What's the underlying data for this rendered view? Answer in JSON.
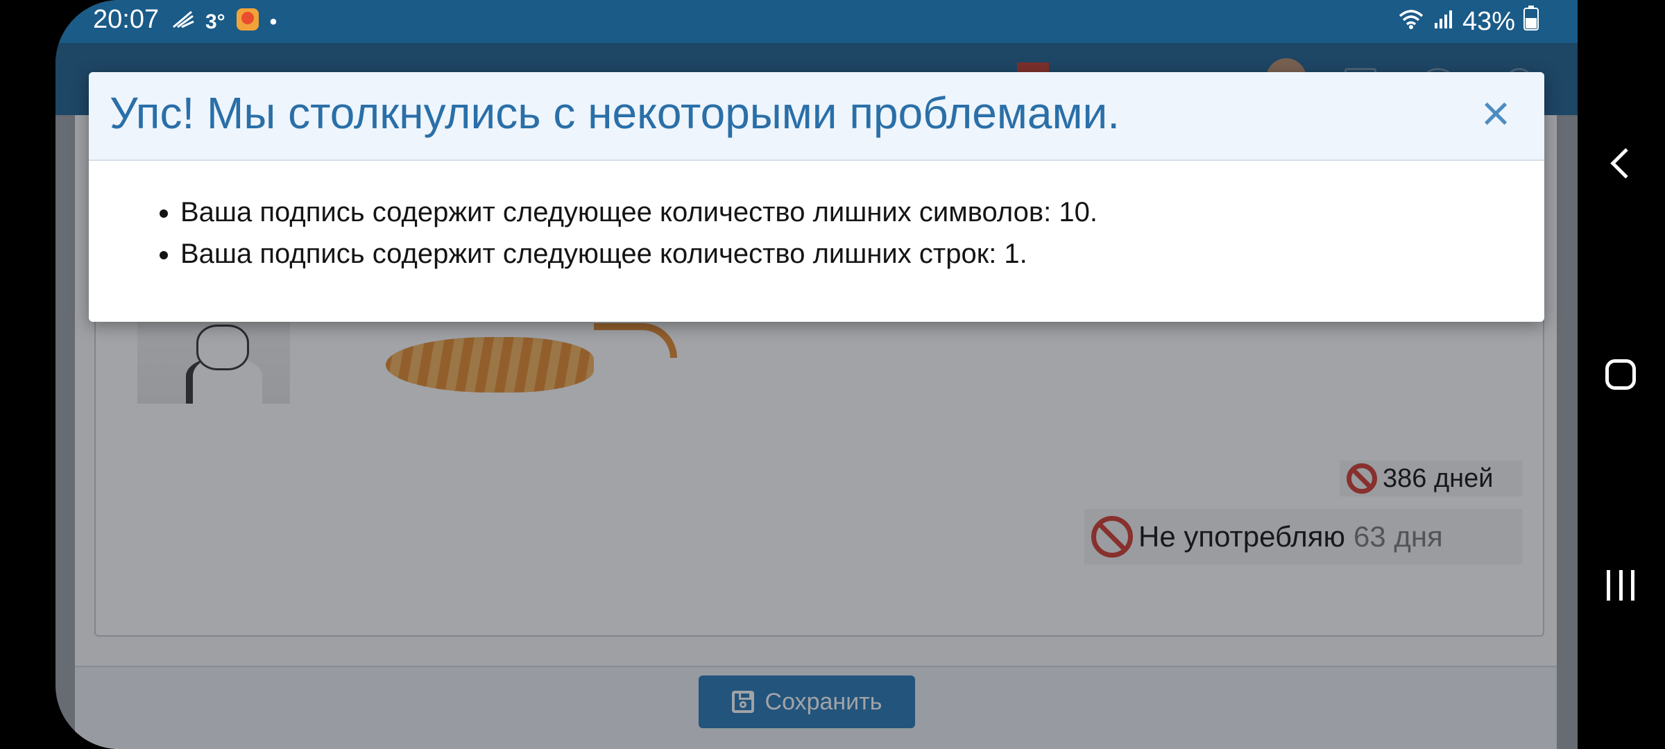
{
  "status_bar": {
    "time": "20:07",
    "temperature": "3°",
    "battery": "43%",
    "icons": [
      "notification-icon",
      "weather-icon",
      "app-icon",
      "wifi-icon",
      "signal-icon",
      "battery-icon"
    ]
  },
  "modal": {
    "title": "Упс! Мы столкнулись с некоторыми проблемами.",
    "close_label": "×",
    "errors": [
      "Ваша подпись содержит следующее количество лишних символов: 10.",
      "Ваша подпись содержит следующее количество лишних строк: 1."
    ]
  },
  "signature_preview": {
    "badge1_text": "386 дней",
    "badge2_text": "Не употребляю",
    "badge2_muted": "63 дня"
  },
  "footer": {
    "save_label": "Сохранить"
  },
  "colors": {
    "header_blue": "#1e5f8e",
    "accent_blue": "#2577b5",
    "title_blue": "#2a6fa8",
    "warning_red": "#d23a2d"
  }
}
